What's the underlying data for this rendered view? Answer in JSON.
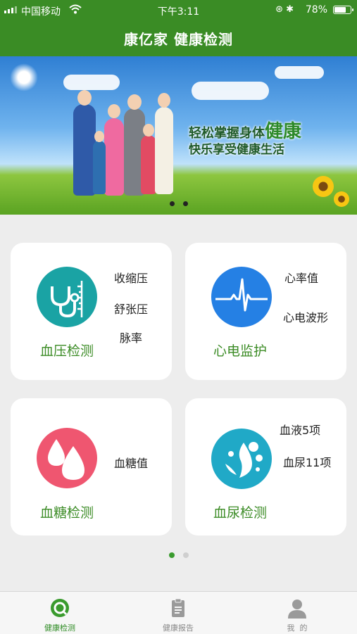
{
  "status": {
    "carrier": "中国移动",
    "time": "下午3:11",
    "battery": "78%",
    "battery_level": 0.78
  },
  "header": {
    "title": "康亿家 健康检测"
  },
  "banner": {
    "line1_a": "轻松掌握身体",
    "line1_b": "健康",
    "line2": "快乐享受健康生活",
    "slide_count": 2
  },
  "cards": [
    {
      "name": "血压检测",
      "items": [
        "收缩压",
        "舒张压",
        "脉率"
      ],
      "icon": "stethoscope-icon"
    },
    {
      "name": "心电监护",
      "items": [
        "心率值",
        "心电波形"
      ],
      "icon": "ecg-wave-icon"
    },
    {
      "name": "血糖检测",
      "items": [
        "血糖值"
      ],
      "icon": "blood-drop-icon"
    },
    {
      "name": "血尿检测",
      "items": [
        "血液5项",
        "血尿11项"
      ],
      "icon": "splash-drop-icon"
    }
  ],
  "pager": {
    "current": 1,
    "total": 2
  },
  "tabs": [
    {
      "label": "健康检测",
      "icon": "health-check-icon",
      "active": true
    },
    {
      "label": "健康报告",
      "icon": "report-clipboard-icon",
      "active": false
    },
    {
      "label": "我  的",
      "icon": "profile-person-icon",
      "active": false
    }
  ],
  "colors": {
    "header": "#3a8c25",
    "accent_green": "#3c8c26",
    "bp": "#1aa3a4",
    "ecg": "#2580e4",
    "glucose": "#ef5670",
    "urine": "#20a9c7"
  }
}
